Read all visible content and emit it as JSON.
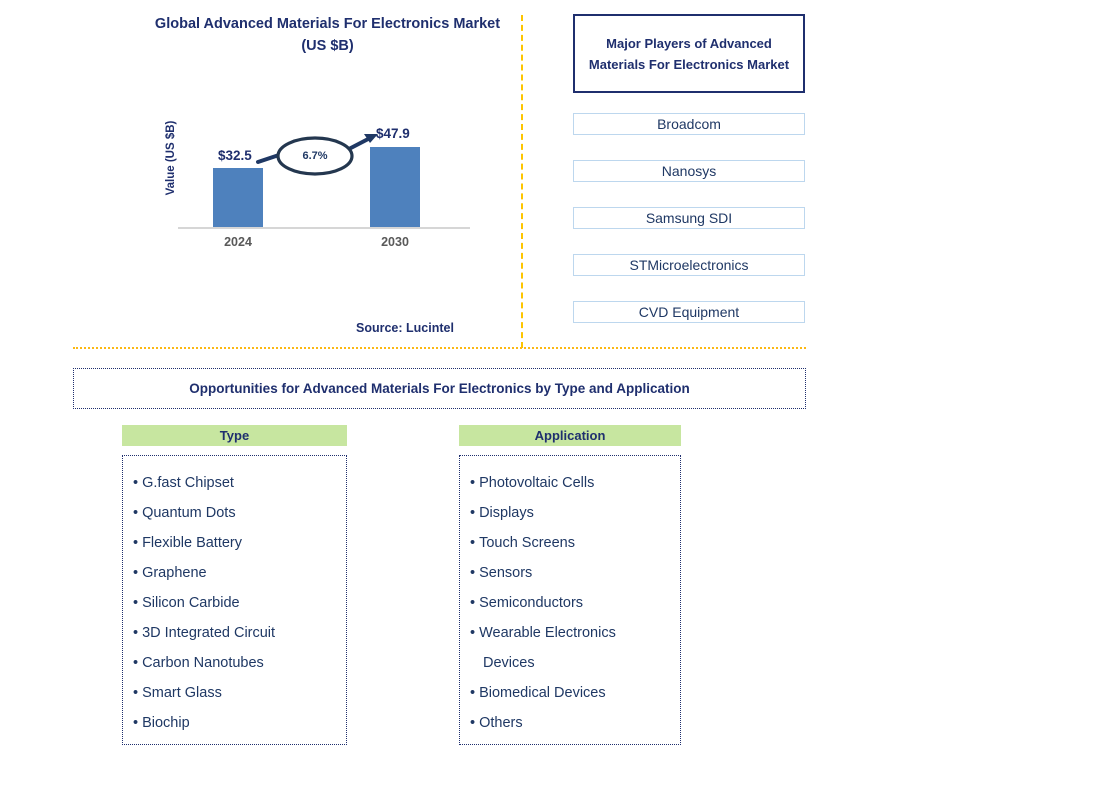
{
  "chart_panel": {
    "title": "Global Advanced Materials For Electronics Market (US $B)",
    "source": "Source: Lucintel"
  },
  "chart_data": {
    "type": "bar",
    "title": "Global Advanced Materials For Electronics Market (US $B)",
    "categories": [
      "2024",
      "2030"
    ],
    "values": [
      32.5,
      47.9
    ],
    "value_labels": [
      "$32.5",
      "$47.9"
    ],
    "xlabel": "",
    "ylabel": "Value (US $B)",
    "ylim": [
      0,
      55
    ],
    "grid": false,
    "legend": null,
    "annotations": [
      {
        "text": "6.7%",
        "kind": "cagr-callout",
        "from": "2024",
        "to": "2030"
      }
    ],
    "series": [
      {
        "name": "Value (US $B)",
        "values": [
          32.5,
          47.9
        ],
        "color": "#4e81bd"
      }
    ]
  },
  "players_panel": {
    "header": "Major Players of Advanced Materials For Electronics Market",
    "items": [
      {
        "label": "Broadcom"
      },
      {
        "label": "Nanosys"
      },
      {
        "label": "Samsung SDI"
      },
      {
        "label": "STMicroelectronics"
      },
      {
        "label": "CVD Equipment"
      }
    ]
  },
  "opportunities": {
    "banner": "Opportunities for Advanced Materials For Electronics by Type and Application",
    "columns": [
      {
        "header": "Type",
        "items": [
          {
            "text": "G.fast Chipset"
          },
          {
            "text": "Quantum Dots"
          },
          {
            "text": "Flexible Battery"
          },
          {
            "text": "Graphene"
          },
          {
            "text": "Silicon Carbide"
          },
          {
            "text": "3D Integrated Circuit"
          },
          {
            "text": "Carbon Nanotubes"
          },
          {
            "text": "Smart Glass"
          },
          {
            "text": "Biochip"
          }
        ]
      },
      {
        "header": "Application",
        "items": [
          {
            "text": "Photovoltaic Cells"
          },
          {
            "text": "Displays"
          },
          {
            "text": "Touch Screens"
          },
          {
            "text": "Sensors"
          },
          {
            "text": "Semiconductors"
          },
          {
            "text": "Wearable Electronics"
          },
          {
            "text": "Devices",
            "continuation": true
          },
          {
            "text": "Biomedical Devices"
          },
          {
            "text": "Others"
          }
        ]
      }
    ]
  },
  "colors": {
    "navy": "#1f2f6e",
    "text_blue": "#1f3864",
    "bar_blue": "#4e81bd",
    "divider_gold": "#fcb813",
    "header_green": "#c7e6a0",
    "tick_gray": "#595959"
  },
  "bullet": "•"
}
